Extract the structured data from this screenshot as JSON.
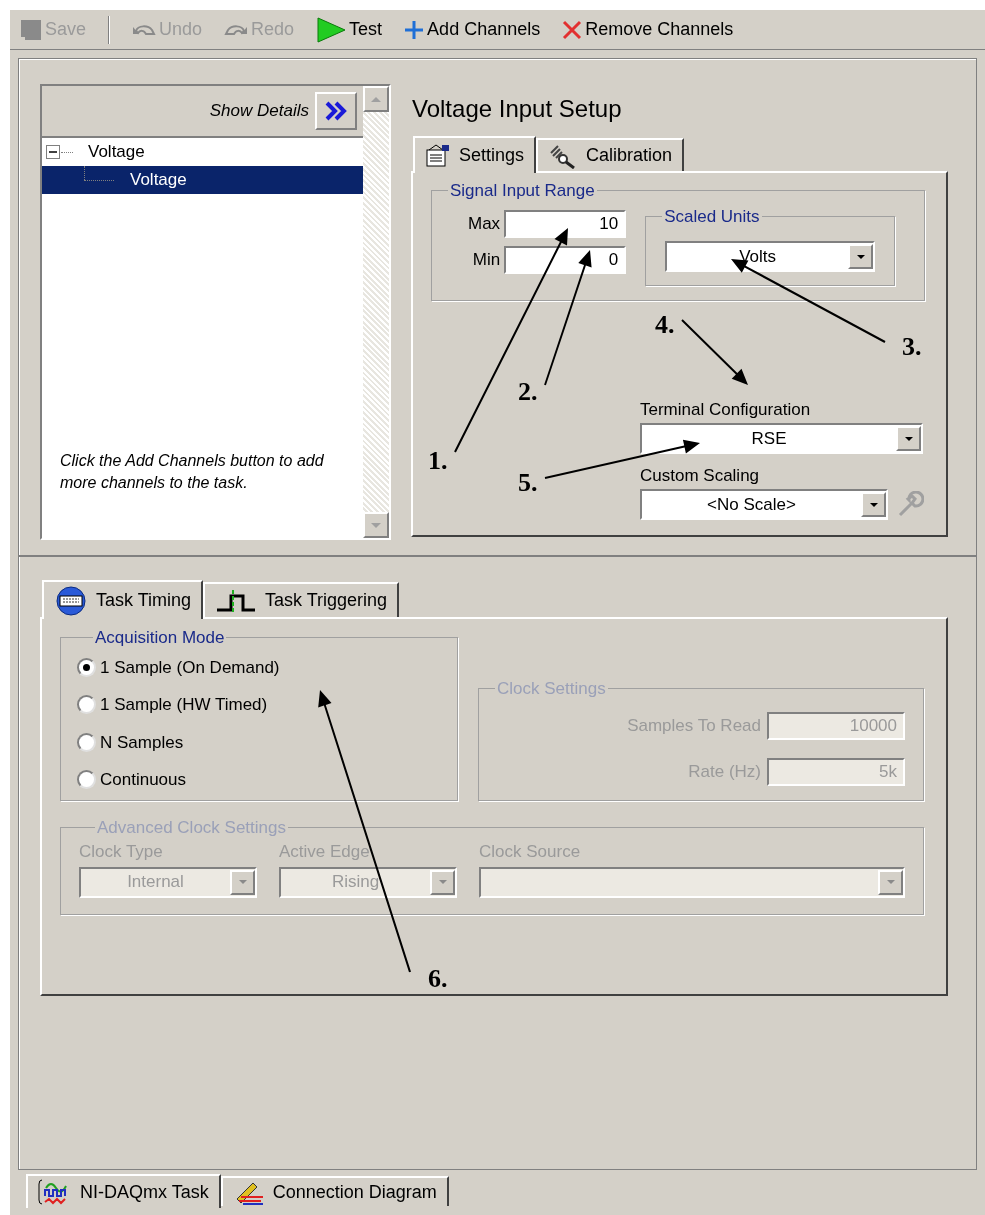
{
  "toolbar": [
    {
      "label": "Save",
      "kind": "save",
      "disabled": true
    },
    {
      "label": "Undo",
      "kind": "undo",
      "disabled": true
    },
    {
      "label": "Redo",
      "kind": "redo",
      "disabled": true
    },
    {
      "label": "Test",
      "kind": "test",
      "disabled": false
    },
    {
      "label": "Add Channels",
      "kind": "add",
      "disabled": false
    },
    {
      "label": "Remove Channels",
      "kind": "remove",
      "disabled": false
    }
  ],
  "channel_list": {
    "show_details": "Show Details",
    "tree": [
      {
        "label": "Voltage",
        "expanded": true,
        "selected": false,
        "children": [
          {
            "label": "Voltage",
            "selected": true
          }
        ]
      }
    ],
    "hint": "Click the Add Channels button to add more channels to the task."
  },
  "setup": {
    "title": "Voltage Input Setup",
    "tabs": [
      {
        "label": "Settings",
        "kind": "settings",
        "selected": true
      },
      {
        "label": "Calibration",
        "kind": "calibration",
        "selected": false
      }
    ],
    "signal_input_range": {
      "title": "Signal Input Range",
      "max_label": "Max",
      "max": "10",
      "min_label": "Min",
      "min": "0"
    },
    "scaled_units": {
      "title": "Scaled Units",
      "value": "Volts"
    },
    "terminal_configuration": {
      "label": "Terminal Configuration",
      "value": "RSE"
    },
    "custom_scaling": {
      "label": "Custom Scaling",
      "value": "<No Scale>"
    }
  },
  "timing": {
    "tabs": [
      {
        "label": "Task Timing",
        "kind": "timing",
        "selected": true
      },
      {
        "label": "Task Triggering",
        "kind": "triggering",
        "selected": false
      }
    ],
    "acquisition_mode": {
      "title": "Acquisition Mode",
      "options": [
        {
          "label": "1 Sample (On Demand)",
          "selected": true
        },
        {
          "label": "1 Sample (HW Timed)",
          "selected": false
        },
        {
          "label": "N Samples",
          "selected": false
        },
        {
          "label": "Continuous",
          "selected": false
        }
      ]
    },
    "clock_settings": {
      "title": "Clock Settings",
      "disabled": true,
      "samples_label": "Samples To Read",
      "samples": "10000",
      "rate_label": "Rate (Hz)",
      "rate": "5k"
    },
    "advanced_clock_settings": {
      "title": "Advanced Clock Settings",
      "disabled": true,
      "fields": [
        {
          "label": "Clock Type",
          "value": "Internal"
        },
        {
          "label": "Active Edge",
          "value": "Rising"
        },
        {
          "label": "Clock Source"
        }
      ]
    }
  },
  "bottom_tabs": [
    {
      "label": "NI-DAQmx Task",
      "kind": "task",
      "selected": true
    },
    {
      "label": "Connection Diagram",
      "kind": "diagram",
      "selected": false
    }
  ],
  "callouts": [
    {
      "label": "1."
    },
    {
      "label": "2."
    },
    {
      "label": "3."
    },
    {
      "label": "4."
    },
    {
      "label": "5."
    },
    {
      "label": "6."
    }
  ]
}
